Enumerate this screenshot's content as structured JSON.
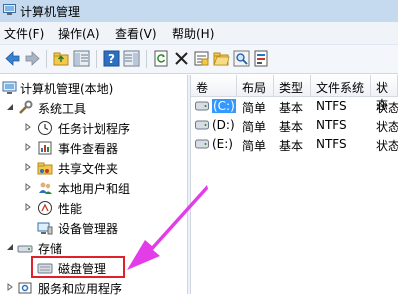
{
  "window": {
    "title": "计算机管理"
  },
  "menu": [
    "文件(F)",
    "操作(A)",
    "查看(V)",
    "帮助(H)"
  ],
  "toolbar": {
    "icons": [
      "back-icon",
      "forward-icon",
      "up-folder-icon",
      "show-hide-tree-icon",
      "help-icon",
      "show-hide-action-icon",
      "refresh-icon",
      "delete-icon",
      "properties-icon",
      "open-folder-icon",
      "search-icon",
      "settings-icon"
    ]
  },
  "tree": {
    "root": "计算机管理(本地)",
    "system_tools": "系统工具",
    "items": [
      "任务计划程序",
      "事件查看器",
      "共享文件夹",
      "本地用户和组",
      "性能",
      "设备管理器"
    ],
    "storage": "存储",
    "disk_management": "磁盘管理",
    "services": "服务和应用程序"
  },
  "table": {
    "columns": [
      "卷",
      "布局",
      "类型",
      "文件系统",
      "状态"
    ],
    "rows": [
      {
        "volume": "(C:)",
        "layout": "简单",
        "type": "基本",
        "fs": "NTFS",
        "status": "状态",
        "selected": true
      },
      {
        "volume": "(D:)",
        "layout": "简单",
        "type": "基本",
        "fs": "NTFS",
        "status": "状态",
        "selected": false
      },
      {
        "volume": "(E:)",
        "layout": "简单",
        "type": "基本",
        "fs": "NTFS",
        "status": "状态",
        "selected": false
      }
    ]
  },
  "colors": {
    "highlight_box": "#e0202a",
    "arrow": "#e23de8",
    "selection": "#3399ff"
  }
}
